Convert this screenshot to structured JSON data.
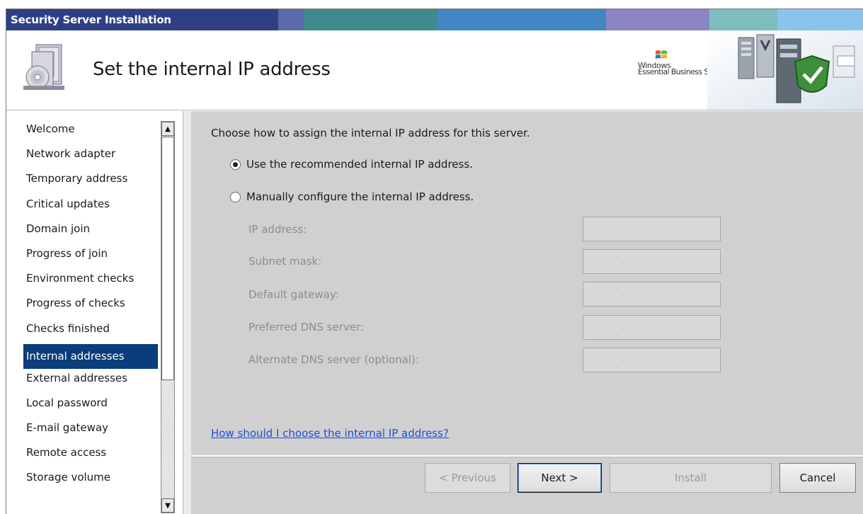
{
  "window": {
    "title": "Security Server Installation"
  },
  "titlebar_colors": [
    "#2e3f86",
    "#5a6aaa",
    "#3e8a8c",
    "#4286c4",
    "#8a86c4",
    "#7fbcbc",
    "#8ac4ec",
    "#c8c4ec"
  ],
  "banner": {
    "page_title": "Set the internal IP address",
    "brand_line1": "Windows",
    "brand_line2": "Essential Business Server"
  },
  "nav": {
    "items": [
      {
        "label": "Welcome",
        "selected": false
      },
      {
        "label": "Network adapter",
        "selected": false
      },
      {
        "label": "Temporary address",
        "selected": false
      },
      {
        "label": "Critical updates",
        "selected": false
      },
      {
        "label": "Domain join",
        "selected": false
      },
      {
        "label": "Progress of join",
        "selected": false
      },
      {
        "label": "Environment checks",
        "selected": false
      },
      {
        "label": "Progress of checks",
        "selected": false
      },
      {
        "label": "Checks finished",
        "selected": false
      },
      {
        "label": "Internal addresses",
        "selected": true
      },
      {
        "label": "External addresses",
        "selected": false
      },
      {
        "label": "Local password",
        "selected": false
      },
      {
        "label": "E-mail gateway",
        "selected": false
      },
      {
        "label": "Remote access",
        "selected": false
      },
      {
        "label": "Storage volume",
        "selected": false
      }
    ],
    "scroll_up": "▲",
    "scroll_down": "▼"
  },
  "content": {
    "lead": "Choose how to assign the internal IP address for this server.",
    "option_recommended": "Use the recommended internal IP address.",
    "option_manual": "Manually configure the internal IP address.",
    "selected_option": "recommended",
    "fields": [
      {
        "label": "IP address:",
        "value": ". . ."
      },
      {
        "label": "Subnet mask:",
        "value": ". . ."
      },
      {
        "label": "Default gateway:",
        "value": ". . ."
      },
      {
        "label": "Preferred DNS server:",
        "value": ". . ."
      },
      {
        "label": "Alternate DNS server (optional):",
        "value": ". . ."
      }
    ],
    "help_link": "How should I choose the internal IP address?"
  },
  "footer": {
    "previous": "< Previous",
    "next": "Next >",
    "install": "Install",
    "cancel": "Cancel"
  }
}
